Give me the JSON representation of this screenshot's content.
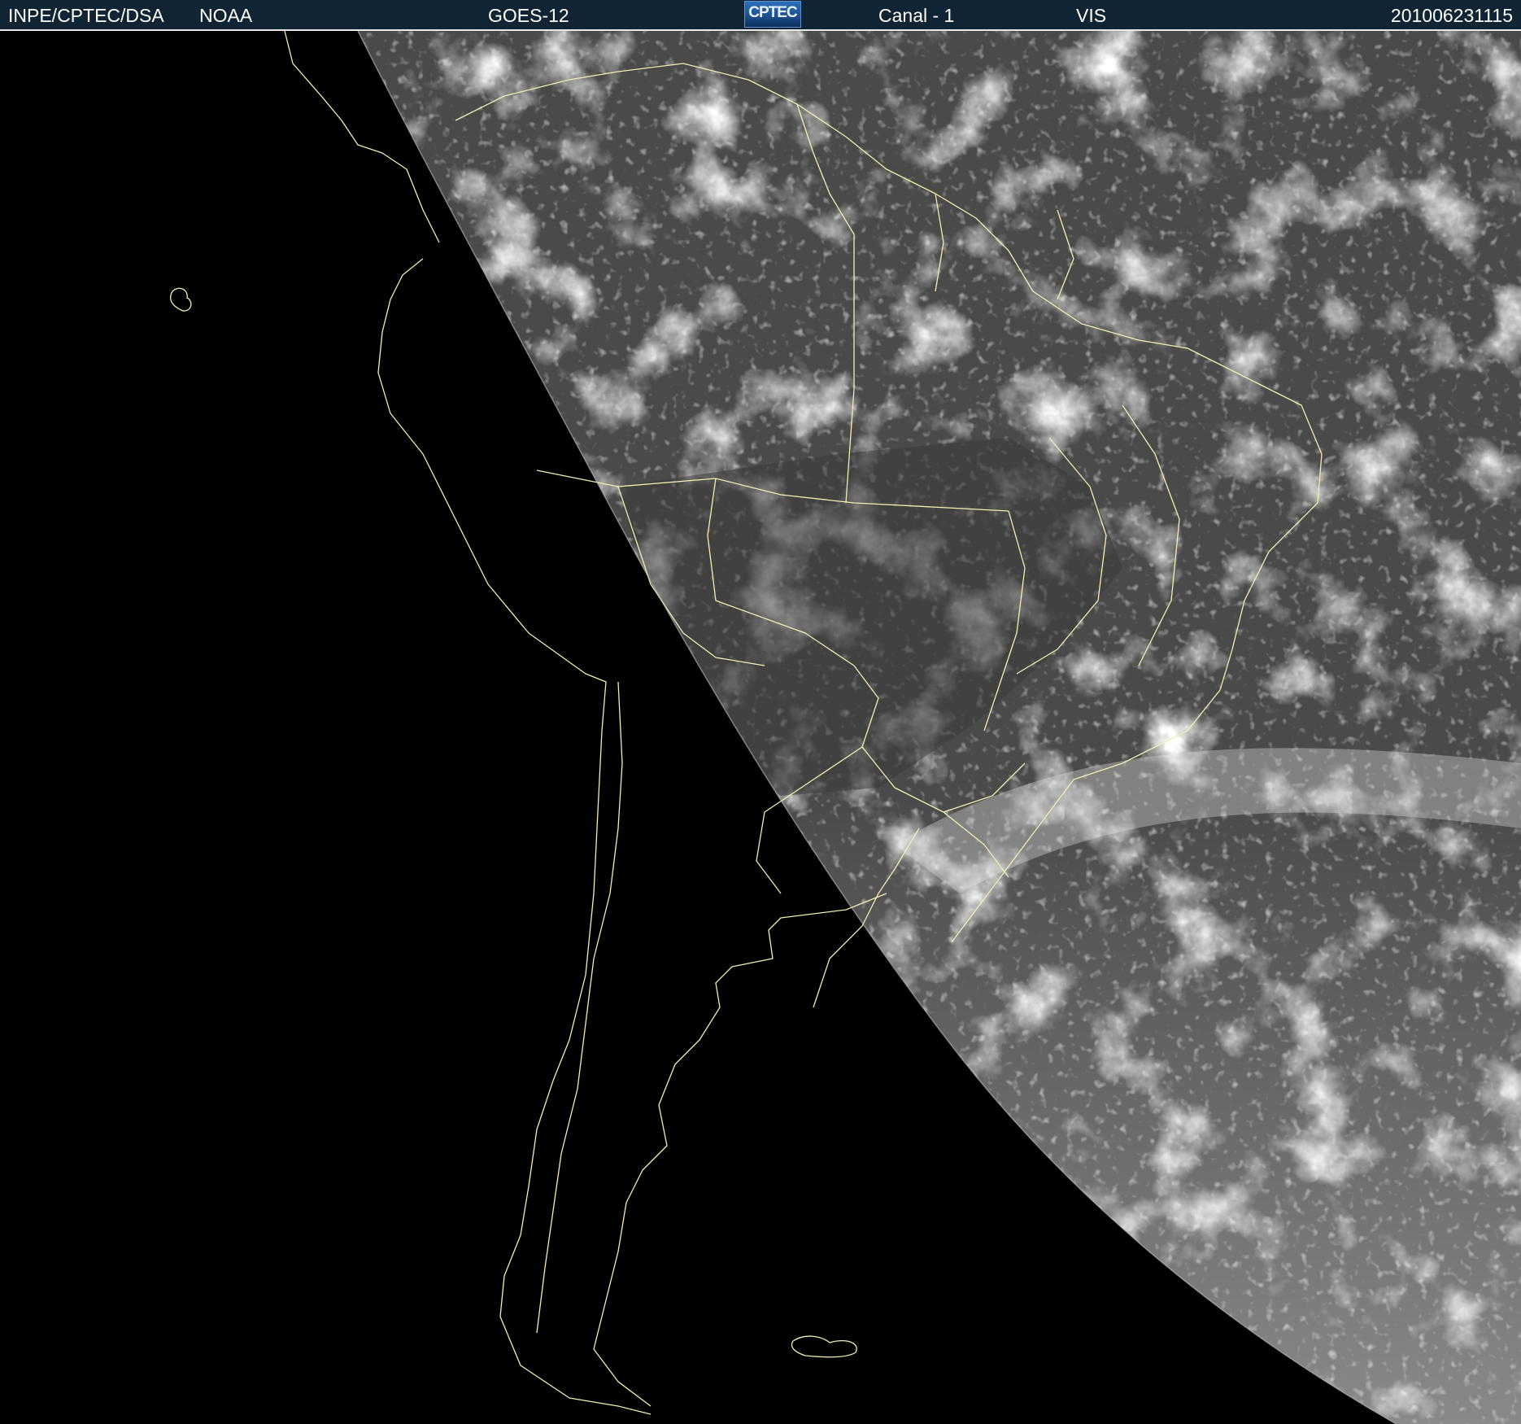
{
  "header": {
    "agency": "INPE/CPTEC/DSA",
    "source": "NOAA",
    "satellite": "GOES-12",
    "logo_text": "CPTEC",
    "channel": "Canal - 1",
    "band": "VIS",
    "timestamp": "201006231115"
  },
  "colors": {
    "header_bg": "#102433",
    "space": "#000000",
    "border_lines": "#f2f0b0"
  },
  "map": {
    "type": "satellite-visible-imagery",
    "region": "south-america"
  }
}
